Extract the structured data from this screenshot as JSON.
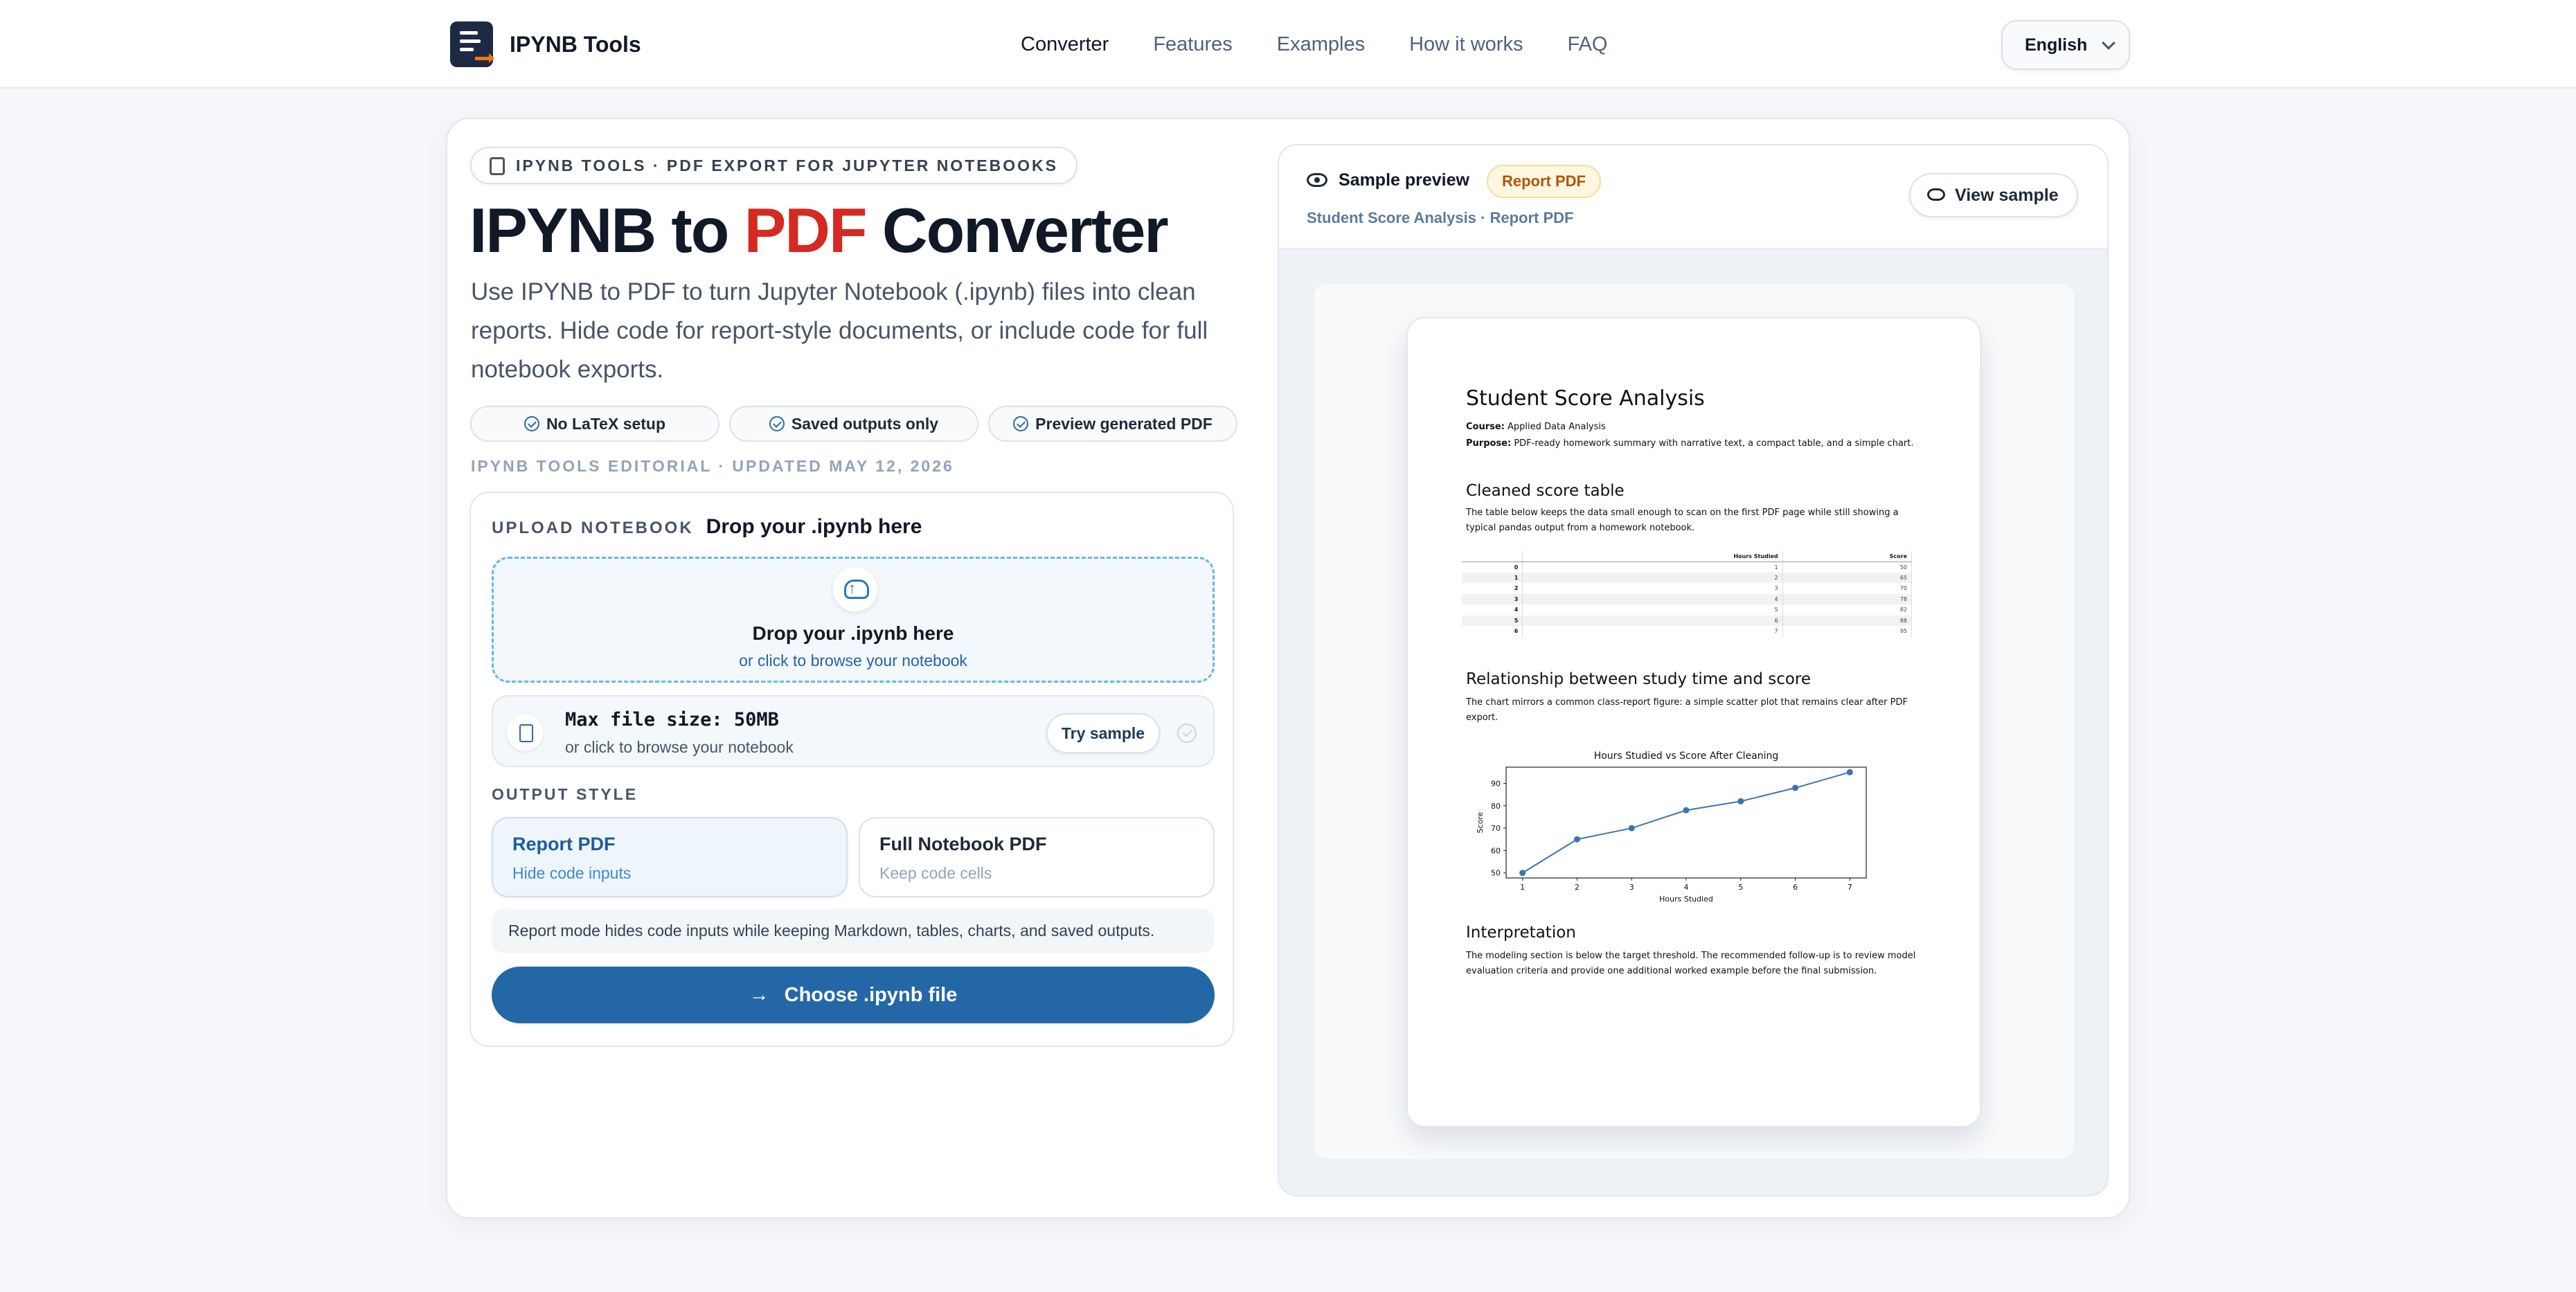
{
  "nav": {
    "brand": "IPYNB Tools",
    "links": [
      "Converter",
      "Features",
      "Examples",
      "How it works",
      "FAQ"
    ],
    "language": "English"
  },
  "hero": {
    "pill": "IPYNB TOOLS · PDF EXPORT FOR JUPYTER NOTEBOOKS",
    "title_a": "IPYNB to ",
    "title_b": "PDF",
    "title_c": " Converter",
    "lead": "Use IPYNB to PDF to turn Jupyter Notebook (.ipynb) files into clean reports. Hide code for report-style documents, or include code for full notebook exports.",
    "chips": [
      "No LaTeX setup",
      "Saved outputs only",
      "Preview generated PDF"
    ],
    "editorial": "IPYNB TOOLS EDITORIAL · UPDATED MAY 12, 2026"
  },
  "upload": {
    "label": "UPLOAD NOTEBOOK",
    "heading": "Drop your .ipynb here",
    "drop_title": "Drop your .ipynb here",
    "drop_sub": "or click to browse your notebook",
    "max_size": "Max file size: 50MB",
    "max_sub": "or click to browse your notebook",
    "try_sample": "Try sample",
    "output_style_label": "OUTPUT STYLE",
    "options": [
      {
        "title": "Report PDF",
        "sub": "Hide code inputs"
      },
      {
        "title": "Full Notebook PDF",
        "sub": "Keep code cells"
      }
    ],
    "note": "Report mode hides code inputs while keeping Markdown, tables, charts, and saved outputs.",
    "cta": "Choose .ipynb file"
  },
  "preview": {
    "title": "Sample preview",
    "badge": "Report PDF",
    "subtitle": "Student Score Analysis · Report PDF",
    "view_sample": "View sample",
    "doc": {
      "h1": "Student Score Analysis",
      "course_label": "Course:",
      "course": " Applied Data Analysis",
      "purpose_label": "Purpose:",
      "purpose": " PDF-ready homework summary with narrative text, a compact table, and a simple chart.",
      "h2_table": "Cleaned score table",
      "p_table": "The table below keeps the data small enough to scan on the first PDF page while still showing a typical pandas output from a homework notebook.",
      "table_headers": [
        "",
        "Hours Studied",
        "Score"
      ],
      "table_rows": [
        [
          "0",
          "1",
          "50"
        ],
        [
          "1",
          "2",
          "65"
        ],
        [
          "2",
          "3",
          "70"
        ],
        [
          "3",
          "4",
          "78"
        ],
        [
          "4",
          "5",
          "82"
        ],
        [
          "5",
          "6",
          "88"
        ],
        [
          "6",
          "7",
          "95"
        ]
      ],
      "h2_chart": "Relationship between study time and score",
      "p_chart": "The chart mirrors a common class-report figure: a simple scatter plot that remains clear after PDF export.",
      "h2_interp": "Interpretation",
      "p_interp": "The modeling section is below the target threshold. The recommended follow-up is to review model evaluation criteria and provide one additional worked example before the final submission."
    }
  },
  "chart_data": {
    "type": "line",
    "title": "Hours Studied vs Score After Cleaning",
    "xlabel": "Hours Studied",
    "ylabel": "Score",
    "x": [
      1,
      2,
      3,
      4,
      5,
      6,
      7
    ],
    "series": [
      {
        "values": [
          50,
          65,
          70,
          78,
          82,
          88,
          95
        ]
      }
    ],
    "xticks": [
      1,
      2,
      3,
      4,
      5,
      6,
      7
    ],
    "yticks": [
      50,
      60,
      70,
      80,
      90
    ],
    "xlim": [
      0.7,
      7.3
    ],
    "ylim": [
      47.75,
      97.25
    ],
    "color": "#3b75af"
  }
}
